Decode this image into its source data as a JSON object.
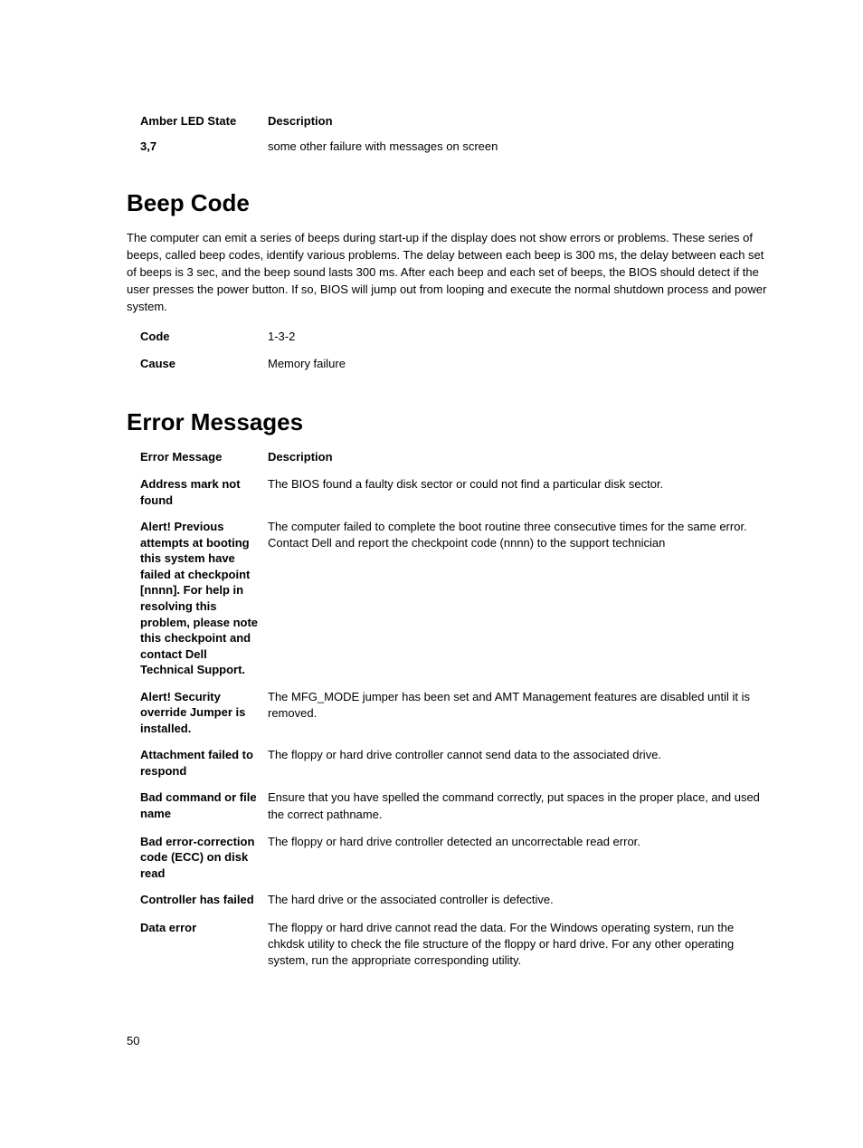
{
  "amberLed": {
    "headers": {
      "state": "Amber LED State",
      "desc": "Description"
    },
    "rows": [
      {
        "state": "3,7",
        "desc": "some other failure with messages on screen"
      }
    ]
  },
  "beepCode": {
    "heading": "Beep Code",
    "intro": "The computer can emit a series of beeps during start-up if the display does not show errors or problems. These series of beeps, called beep codes, identify various problems. The delay between each beep is 300 ms, the delay between each set of beeps is 3 sec, and the beep sound lasts 300 ms. After each beep and each set of beeps, the BIOS should detect if the user presses the power button. If so, BIOS will jump out from looping and execute the normal shutdown process and power system.",
    "table": {
      "codeLabel": "Code",
      "codeValue": "1-3-2",
      "causeLabel": "Cause",
      "causeValue": "Memory failure"
    }
  },
  "errorMessages": {
    "heading": "Error Messages",
    "headers": {
      "msg": "Error Message",
      "desc": "Description"
    },
    "rows": [
      {
        "msg": "Address mark not found",
        "desc": "The BIOS found a faulty disk sector or could not find a particular disk sector."
      },
      {
        "msg": "Alert! Previous attempts at booting this system have failed at checkpoint [nnnn]. For help in resolving this problem, please note this checkpoint and contact Dell Technical Support.",
        "desc": "The computer failed to complete the boot routine three consecutive times for the same error. Contact Dell and report the checkpoint code (nnnn) to the support technician"
      },
      {
        "msg": "Alert! Security override Jumper is installed.",
        "desc": "The MFG_MODE jumper has been set and AMT Management features are disabled until it is removed."
      },
      {
        "msg": "Attachment failed to respond",
        "desc": "The floppy or hard drive controller cannot send data to the associated drive."
      },
      {
        "msg": "Bad command or file name",
        "desc": "Ensure that you have spelled the command correctly, put spaces in the proper place, and used the correct pathname."
      },
      {
        "msg": "Bad error-correction code (ECC) on disk read",
        "desc": "The floppy or hard drive controller detected an uncorrectable read error."
      },
      {
        "msg": "Controller has failed",
        "desc": "The hard drive or the associated controller is defective."
      },
      {
        "msg": "Data error",
        "desc": "The floppy or hard drive cannot read the data. For the Windows operating system, run the chkdsk utility to check the file structure of the floppy or hard drive. For any other operating system, run the appropriate corresponding utility."
      }
    ]
  },
  "pageNumber": "50"
}
